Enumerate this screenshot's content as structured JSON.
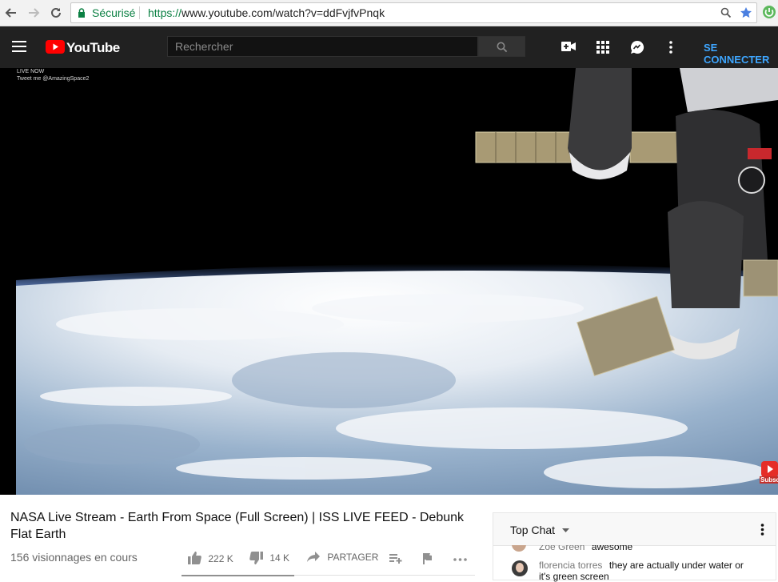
{
  "browser": {
    "secure_label": "Sécurisé",
    "url_scheme": "https://",
    "url_rest": "www.youtube.com/watch?v=ddFvjfvPnqk"
  },
  "header": {
    "logo_text": "YouTube",
    "search_placeholder": "Rechercher",
    "signin_label": "SE CONNECTER",
    "colors": {
      "header_bg": "#212121",
      "accent_red": "#ff0000",
      "link_blue": "#3ea6ff"
    }
  },
  "video": {
    "overlay_line1": "LIVE NOW",
    "overlay_line2": "Tweet me @AmazingSpace2",
    "subscribe_badge": "Subsc"
  },
  "details": {
    "title": "NASA Live Stream - Earth From Space (Full Screen) | ISS LIVE FEED - Debunk Flat Earth",
    "views": "156 visionnages en cours",
    "likes": "222 K",
    "dislikes": "14 K",
    "share_label": "PARTAGER"
  },
  "chat": {
    "title": "Top Chat",
    "messages": [
      {
        "author": "Zoë Green",
        "text": "awesome"
      },
      {
        "author": "florencia torres",
        "text": "they are actually under water or",
        "text2": "it's green screen"
      }
    ]
  }
}
